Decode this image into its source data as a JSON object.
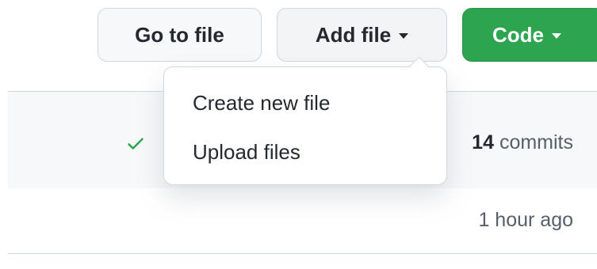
{
  "toolbar": {
    "go_to_file": "Go to file",
    "add_file": "Add file",
    "code": "Code"
  },
  "add_file_menu": {
    "items": [
      {
        "label": "Create new file"
      },
      {
        "label": "Upload files"
      }
    ]
  },
  "commit_bar": {
    "commit_count": "14",
    "commits_label": "commits",
    "status_icon": "check-icon",
    "status_color": "#2da44e"
  },
  "file_row": {
    "time": "1 hour ago"
  },
  "colors": {
    "primary_button": "#2da44e",
    "border": "#d0d7de",
    "header_bg": "#f6f8fa"
  }
}
